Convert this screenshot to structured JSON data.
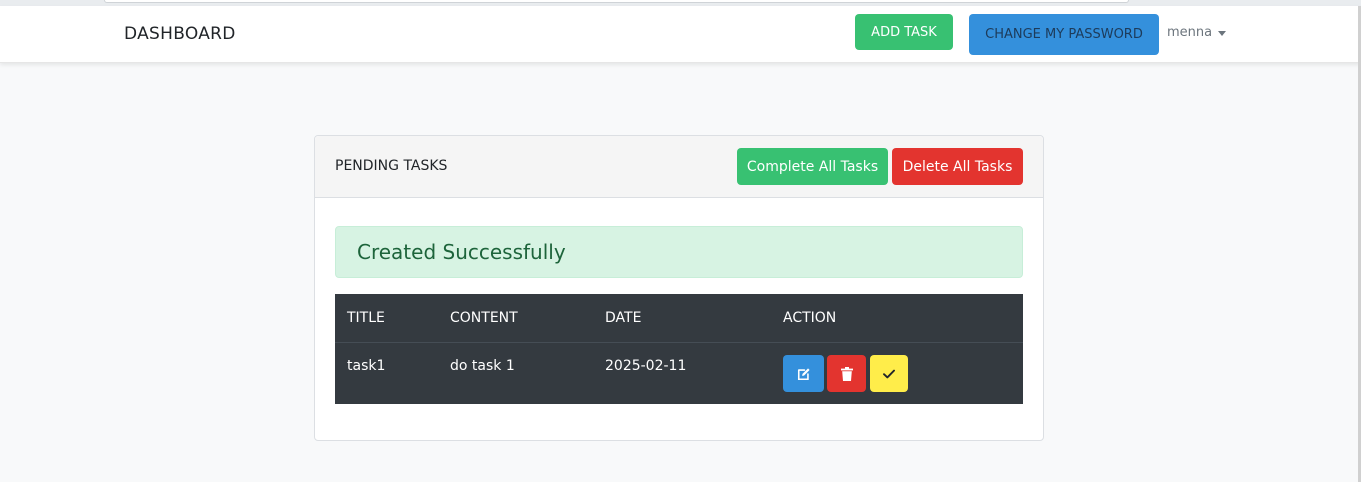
{
  "navbar": {
    "brand": "DASHBOARD",
    "add_task_label": "ADD TASK",
    "change_password_label": "CHANGE MY PASSWORD",
    "user_name": "menna"
  },
  "card": {
    "title": "PENDING TASKS",
    "complete_all_label": "Complete All Tasks",
    "delete_all_label": "Delete All Tasks"
  },
  "alert": {
    "message": "Created Successfully"
  },
  "table": {
    "headers": [
      "TITLE",
      "CONTENT",
      "DATE",
      "ACTION"
    ],
    "rows": [
      {
        "title": "task1",
        "content": "do task 1",
        "date": "2025-02-11"
      }
    ],
    "actions": [
      "edit-icon",
      "trash-icon",
      "check-icon"
    ]
  },
  "colors": {
    "success": "#38c172",
    "primary": "#3490dc",
    "danger": "#e3342f",
    "warning": "#ffed4a",
    "table_dark": "#343a40"
  }
}
